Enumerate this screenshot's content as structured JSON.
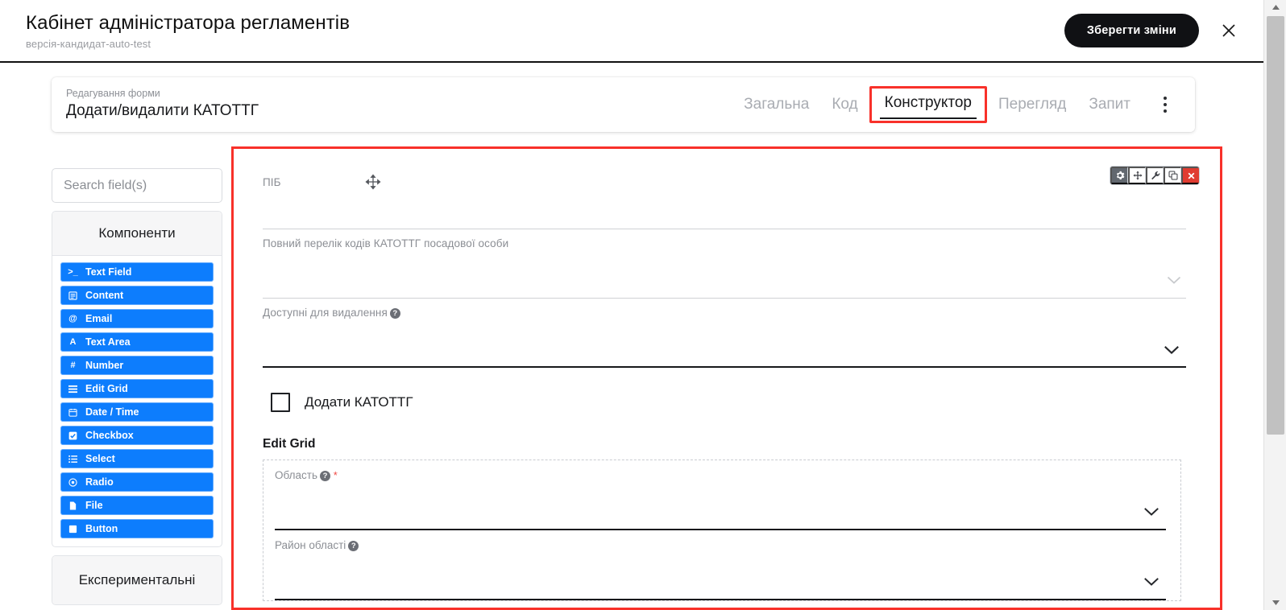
{
  "header": {
    "title": "Кабінет адміністратора регламентів",
    "subtitle": "версія-кандидат-auto-test",
    "save_label": "Зберегти зміни",
    "close_icon": "close-icon"
  },
  "form_context": {
    "eyebrow": "Редагування форми",
    "title": "Додати/видалити КАТОТТГ"
  },
  "tabs": [
    {
      "label": "Загальна",
      "active": false
    },
    {
      "label": "Код",
      "active": false
    },
    {
      "label": "Конструктор",
      "active": true
    },
    {
      "label": "Перегляд",
      "active": false
    },
    {
      "label": "Запит",
      "active": false
    }
  ],
  "kebab": {
    "icon": "more-vertical-icon"
  },
  "sidebar": {
    "search": {
      "placeholder": "Search field(s)",
      "value": ""
    },
    "components_header": "Компоненти",
    "components": [
      {
        "label": "Text Field",
        "icon": "terminal-icon"
      },
      {
        "label": "Content",
        "icon": "content-icon"
      },
      {
        "label": "Email",
        "icon": "at-icon"
      },
      {
        "label": "Text Area",
        "icon": "text-area-icon"
      },
      {
        "label": "Number",
        "icon": "hash-icon"
      },
      {
        "label": "Edit Grid",
        "icon": "grid-icon"
      },
      {
        "label": "Date / Time",
        "icon": "calendar-icon"
      },
      {
        "label": "Checkbox",
        "icon": "checkbox-icon"
      },
      {
        "label": "Select",
        "icon": "list-icon"
      },
      {
        "label": "Radio",
        "icon": "radio-icon"
      },
      {
        "label": "File",
        "icon": "file-icon"
      },
      {
        "label": "Button",
        "icon": "square-icon"
      }
    ],
    "experimental_header": "Експериментальні"
  },
  "canvas": {
    "toolbar": [
      {
        "name": "settings",
        "icon": "gear-icon",
        "state": "active"
      },
      {
        "name": "move",
        "icon": "move-icon",
        "state": "default"
      },
      {
        "name": "edit",
        "icon": "wrench-icon",
        "state": "default"
      },
      {
        "name": "copy",
        "icon": "copy-icon",
        "state": "default"
      },
      {
        "name": "remove",
        "icon": "close-icon",
        "state": "danger"
      }
    ],
    "fields": [
      {
        "label": "ПІБ",
        "type": "textfield",
        "help": false,
        "required": false
      },
      {
        "label": "Повний перелік кодів КАТОТТГ посадової особи",
        "type": "select",
        "help": false,
        "required": false
      },
      {
        "label": "Доступні для видалення",
        "type": "select",
        "help": true,
        "required": false
      }
    ],
    "checkbox": {
      "label": "Додати КАТОТТГ",
      "checked": false
    },
    "edit_grid": {
      "title": "Edit Grid",
      "rows": [
        {
          "label": "Область",
          "help": true,
          "required": true
        },
        {
          "label": "Район області",
          "help": true,
          "required": false
        }
      ]
    },
    "help_glyph": "?",
    "required_glyph": "*"
  },
  "scrollbar": {
    "up_icon": "triangle-up-icon",
    "down_icon": "triangle-down-icon"
  },
  "colors": {
    "accent_blue": "#0d7dfd",
    "highlight_red": "#f8312a",
    "danger_red": "#e03c31",
    "dark": "#101114"
  }
}
